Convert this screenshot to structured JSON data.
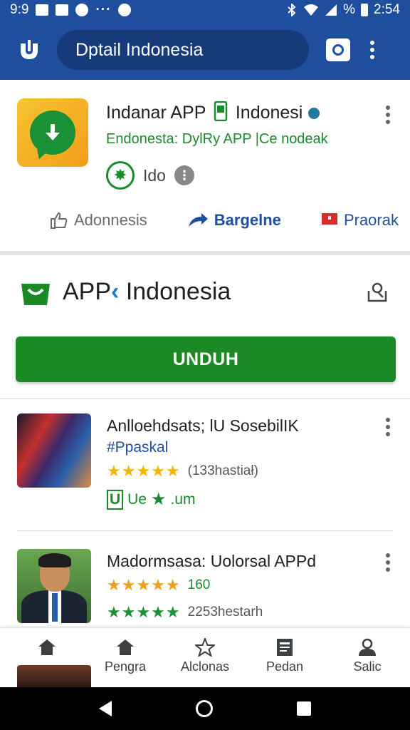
{
  "status_bar": {
    "time_left": "9:9",
    "dots": "···",
    "battery_text": "%",
    "time_right": "2:54"
  },
  "app_bar": {
    "search_text": "Dptail Indonesia",
    "colors": {
      "primary": "#1f4e9e"
    }
  },
  "app_card": {
    "title": "Indanar APP",
    "title_suffix": "Indonesi",
    "subtitle": "Endonesta: DylRy APP |Ce nodeak",
    "rating_label": "Ido",
    "actions": [
      {
        "label": "Adonnesis",
        "icon": "thumb-up-icon"
      },
      {
        "label": "Bargelne",
        "icon": "share-arrow-icon"
      },
      {
        "label": "Praorak",
        "icon": "flag-icon"
      }
    ]
  },
  "section": {
    "title": "APP",
    "title_suffix": "Indonesia",
    "download_label": "UNDUH",
    "accent": "#1b8a24"
  },
  "list": [
    {
      "title": "Anlloehdsats; lU SosebilIK",
      "tag": "#Ppaskal",
      "stars": "★★★★★",
      "count": "(133hastiał)",
      "badge_box": "U",
      "badge_text": "Ue",
      "badge_suffix": ".um"
    },
    {
      "title": "Madormsasa: Uolorsal APPd",
      "stars_a": "★★★★★",
      "count_a": "160",
      "stars_b": "★★★★★",
      "count_b": "2253hestarh"
    }
  ],
  "bottom_nav": [
    {
      "label": "",
      "icon": "home-icon"
    },
    {
      "label": "Pengra",
      "icon": "home-icon"
    },
    {
      "label": "Alclonas",
      "icon": "star-icon"
    },
    {
      "label": "Pedan",
      "icon": "news-icon"
    },
    {
      "label": "Salic",
      "icon": "person-icon"
    }
  ]
}
